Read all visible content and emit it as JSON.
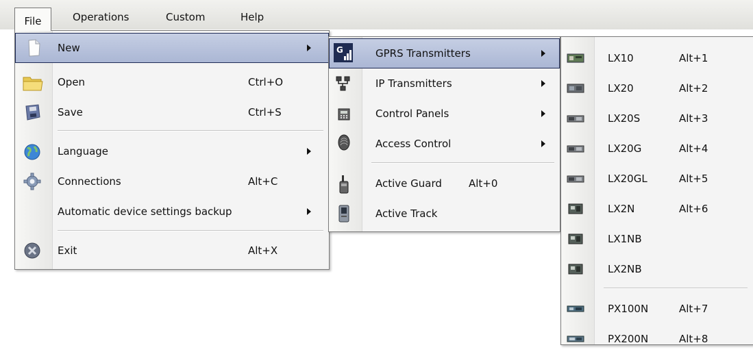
{
  "menubar": {
    "items": [
      {
        "label": "File"
      },
      {
        "label": "Operations"
      },
      {
        "label": "Custom"
      },
      {
        "label": "Help"
      }
    ]
  },
  "file_menu": {
    "items": [
      {
        "label": "New",
        "shortcut": "",
        "icon": "new-document-icon",
        "submenu": true
      },
      {
        "label": "Open",
        "shortcut": "Ctrl+O",
        "icon": "folder-icon"
      },
      {
        "label": "Save",
        "shortcut": "Ctrl+S",
        "icon": "floppy-disk-icon"
      },
      {
        "label": "Language",
        "shortcut": "",
        "icon": "globe-icon",
        "submenu": true
      },
      {
        "label": "Connections",
        "shortcut": "Alt+C",
        "icon": "gear-icon"
      },
      {
        "label": "Automatic device settings backup",
        "shortcut": "",
        "submenu": true
      },
      {
        "label": "Exit",
        "shortcut": "Alt+X",
        "icon": "exit-icon"
      }
    ]
  },
  "new_menu": {
    "items": [
      {
        "label": "GPRS Transmitters",
        "shortcut": "",
        "icon": "gprs-signal-icon",
        "submenu": true
      },
      {
        "label": "IP Transmitters",
        "shortcut": "",
        "icon": "network-icon",
        "submenu": true
      },
      {
        "label": "Control Panels",
        "shortcut": "",
        "icon": "control-panel-icon",
        "submenu": true
      },
      {
        "label": "Access Control",
        "shortcut": "",
        "icon": "fingerprint-icon",
        "submenu": true
      },
      {
        "label": "Active Guard",
        "shortcut": "Alt+0",
        "icon": "guard-device-icon"
      },
      {
        "label": "Active Track",
        "shortcut": "",
        "icon": "tracker-device-icon"
      }
    ]
  },
  "gprs_menu": {
    "items": [
      {
        "label": "LX10",
        "shortcut": "Alt+1"
      },
      {
        "label": "LX20",
        "shortcut": "Alt+2"
      },
      {
        "label": "LX20S",
        "shortcut": "Alt+3"
      },
      {
        "label": "LX20G",
        "shortcut": "Alt+4"
      },
      {
        "label": "LX20GL",
        "shortcut": "Alt+5"
      },
      {
        "label": "LX2N",
        "shortcut": "Alt+6"
      },
      {
        "label": "LX1NB",
        "shortcut": ""
      },
      {
        "label": "LX2NB",
        "shortcut": ""
      },
      {
        "label": "PX100N",
        "shortcut": "Alt+7"
      },
      {
        "label": "PX200N",
        "shortcut": "Alt+8"
      }
    ]
  },
  "colors": {
    "highlight": "#b4bfda",
    "highlight_border": "#1e2a55",
    "menu_bg": "#f4f4f4",
    "menubar_bg": "#e6e6e2"
  }
}
